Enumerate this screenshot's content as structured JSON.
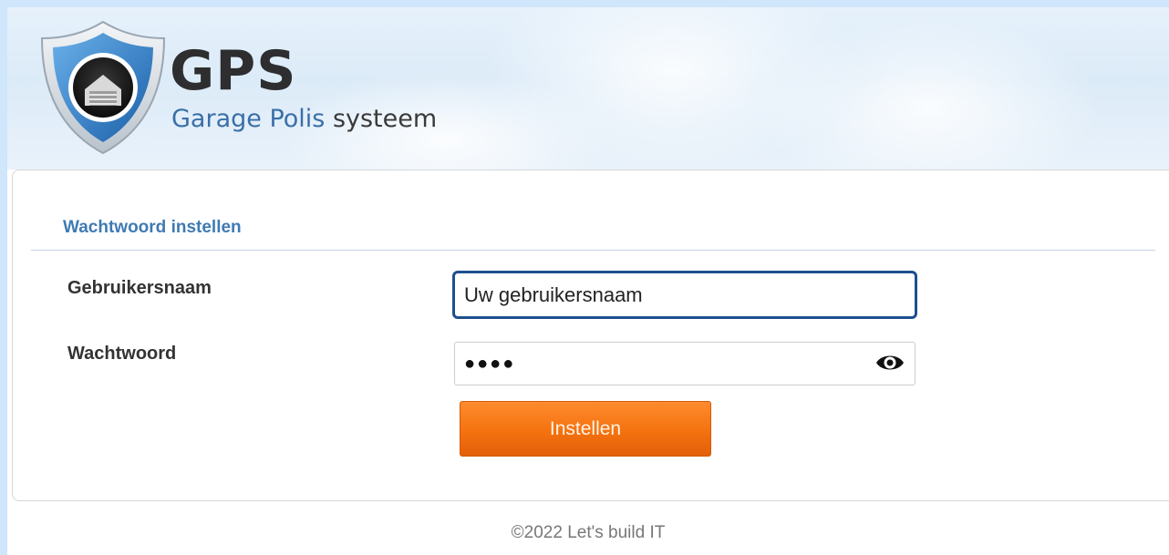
{
  "brand": {
    "title": "GPS",
    "subtitle_part1": "Garage Polis",
    "subtitle_part2": " systeem",
    "logo_icon": "shield-garage-icon",
    "colors": {
      "title": "#2e2e30",
      "subtitle": "#3a6fa8"
    }
  },
  "form": {
    "heading": "Wachtwoord instellen",
    "username_label": "Gebruikersnaam",
    "username_value": "Uw gebruikersnaam",
    "password_label": "Wachtwoord",
    "password_masked": "●●●●",
    "show_password_icon": "eye-icon",
    "submit_label": "Instellen",
    "colors": {
      "heading": "#3f7ab3",
      "button": "#f4720f",
      "focus_border": "#1d4f8f"
    }
  },
  "footer": {
    "copyright": "©2022 Let's build IT"
  }
}
